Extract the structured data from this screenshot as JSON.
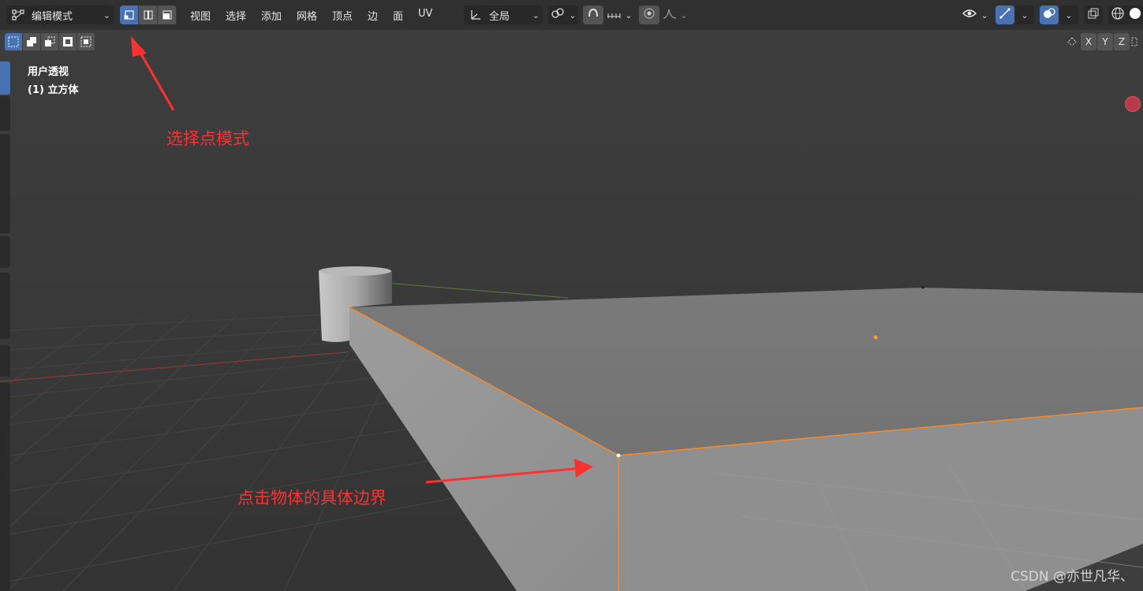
{
  "header": {
    "mode_label": "编辑模式",
    "menu": [
      "视图",
      "选择",
      "添加",
      "网格",
      "顶点",
      "边",
      "面",
      "UV"
    ],
    "transform_orientation": "全局"
  },
  "axis": {
    "x": "X",
    "y": "Y",
    "z": "Z"
  },
  "viewport": {
    "view_name": "用户透视",
    "object_name": "(1) 立方体"
  },
  "annotations": {
    "vertex_mode": "选择点模式",
    "click_edge": "点击物体的具体边界"
  },
  "watermark": "CSDN @亦世凡华、",
  "colors": {
    "accent": "#4772b3",
    "annotation": "#ff3030",
    "selection": "#ff8a1f"
  }
}
